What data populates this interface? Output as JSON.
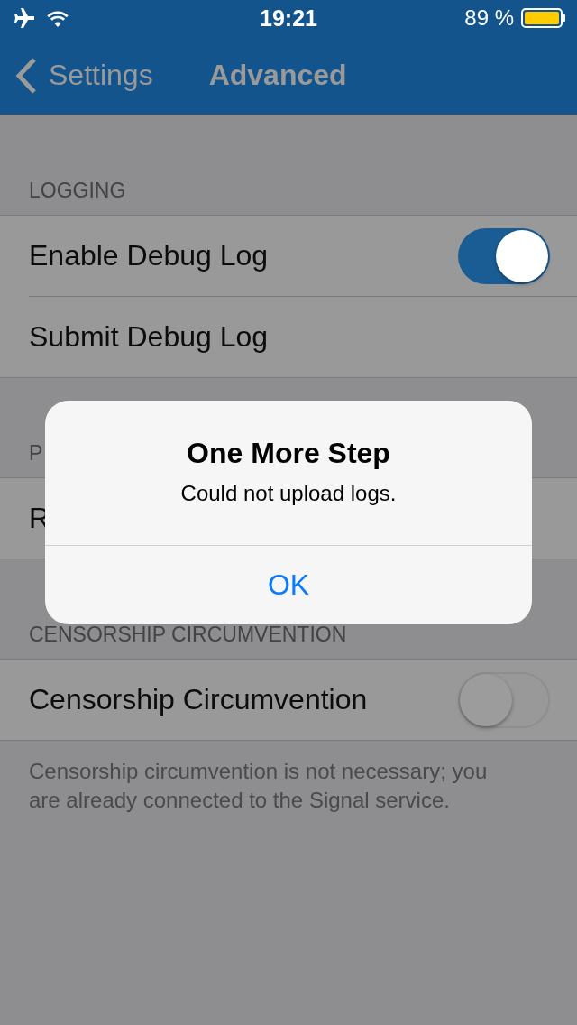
{
  "status_bar": {
    "time": "19:21",
    "battery": "89 %"
  },
  "nav": {
    "back": "Settings",
    "title": "Advanced"
  },
  "sections": [
    {
      "header": "LOGGING",
      "rows": [
        {
          "label": "Enable Debug Log",
          "kind": "switch",
          "on": true
        },
        {
          "label": "Submit Debug Log",
          "kind": "link"
        }
      ]
    },
    {
      "header": "P",
      "rows": [
        {
          "label": "R",
          "kind": "link"
        }
      ]
    },
    {
      "header": "CENSORSHIP CIRCUMVENTION",
      "rows": [
        {
          "label": "Censorship Circumvention",
          "kind": "switch",
          "on": false
        }
      ],
      "footer": "Censorship circumvention is not necessary; you are already connected to the Signal service."
    }
  ],
  "alert": {
    "title": "One More Step",
    "message": "Could not upload logs.",
    "button": "OK"
  }
}
